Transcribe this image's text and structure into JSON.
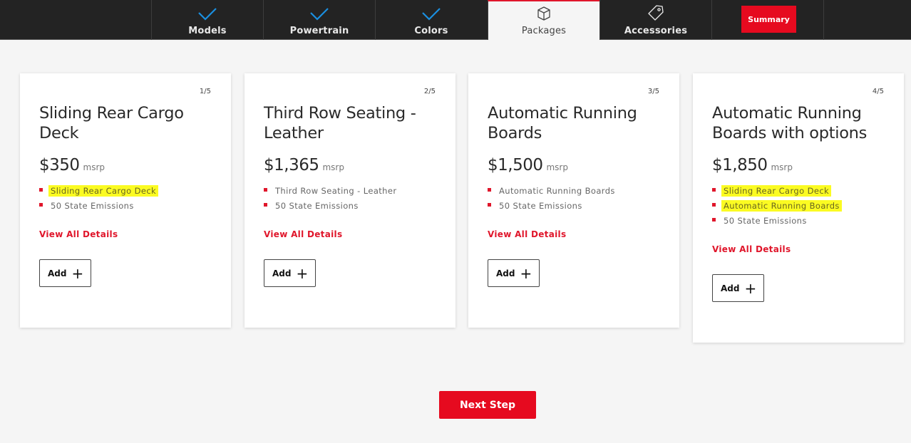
{
  "nav": {
    "tabs": [
      {
        "label": "Models",
        "icon": "check-icon",
        "state": "complete"
      },
      {
        "label": "Powertrain",
        "icon": "check-icon",
        "state": "complete"
      },
      {
        "label": "Colors",
        "icon": "check-icon",
        "state": "complete"
      },
      {
        "label": "Packages",
        "icon": "package-box-icon",
        "state": "active"
      },
      {
        "label": "Accessories",
        "icon": "tag-icon",
        "state": "pending"
      }
    ],
    "summary_label": "Summary"
  },
  "colors": {
    "accent_red": "#e60a1f",
    "check_blue": "#1a8fe0",
    "nav_bg": "#232323",
    "highlight_yellow": "#fbfb22"
  },
  "packages": [
    {
      "count": "1/5",
      "title": "Sliding Rear Cargo Deck",
      "price": "$350",
      "price_unit": "msrp",
      "features": [
        {
          "text": "Sliding Rear Cargo Deck",
          "highlighted": true
        },
        {
          "text": "50 State Emissions",
          "highlighted": false
        }
      ],
      "details_label": "View All Details",
      "add_label": "Add"
    },
    {
      "count": "2/5",
      "title": "Third Row Seating - Leather",
      "price": "$1,365",
      "price_unit": "msrp",
      "features": [
        {
          "text": "Third Row Seating - Leather",
          "highlighted": false
        },
        {
          "text": "50 State Emissions",
          "highlighted": false
        }
      ],
      "details_label": "View All Details",
      "add_label": "Add"
    },
    {
      "count": "3/5",
      "title": "Automatic Running Boards",
      "price": "$1,500",
      "price_unit": "msrp",
      "features": [
        {
          "text": "Automatic Running Boards",
          "highlighted": false
        },
        {
          "text": "50 State Emissions",
          "highlighted": false
        }
      ],
      "details_label": "View All Details",
      "add_label": "Add"
    },
    {
      "count": "4/5",
      "title": "Automatic Running Boards with options",
      "price": "$1,850",
      "price_unit": "msrp",
      "features": [
        {
          "text": "Sliding Rear Cargo Deck",
          "highlighted": true
        },
        {
          "text": "Automatic Running Boards",
          "highlighted": true
        },
        {
          "text": "50 State Emissions",
          "highlighted": false
        }
      ],
      "details_label": "View All Details",
      "add_label": "Add"
    }
  ],
  "footer": {
    "next_label": "Next Step"
  }
}
